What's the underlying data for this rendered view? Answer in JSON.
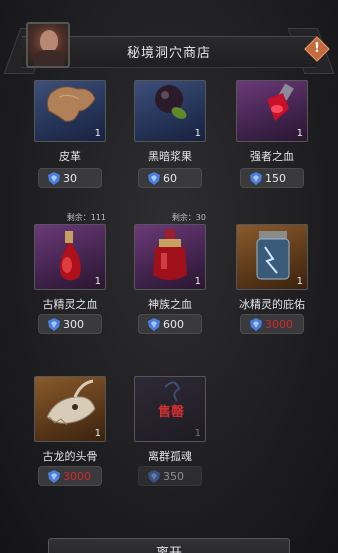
{
  "shop": {
    "title": "秘境洞穴商店",
    "info_label": "!"
  },
  "items": [
    {
      "name": "皮革",
      "qty": "1",
      "price": "30",
      "remaining": ""
    },
    {
      "name": "黑暗浆果",
      "qty": "1",
      "price": "60",
      "remaining": ""
    },
    {
      "name": "强者之血",
      "qty": "1",
      "price": "150",
      "remaining": ""
    },
    {
      "name": "古精灵之血",
      "qty": "1",
      "price": "300",
      "remaining": "剩余：111"
    },
    {
      "name": "神族之血",
      "qty": "1",
      "price": "600",
      "remaining": "剩余：30"
    },
    {
      "name": "冰精灵的庇佑",
      "qty": "1",
      "price": "3000",
      "remaining": ""
    },
    {
      "name": "古龙的头骨",
      "qty": "1",
      "price": "3000",
      "remaining": ""
    },
    {
      "name": "离群孤魂",
      "qty": "1",
      "price": "350",
      "remaining": "",
      "sold_label": "售罄"
    }
  ],
  "footer": {
    "leave_label": "离开"
  },
  "colors": {
    "price_affordable": "#e8e8e8",
    "price_unaffordable": "#d22a2a",
    "gem": "#4a7fe0"
  }
}
